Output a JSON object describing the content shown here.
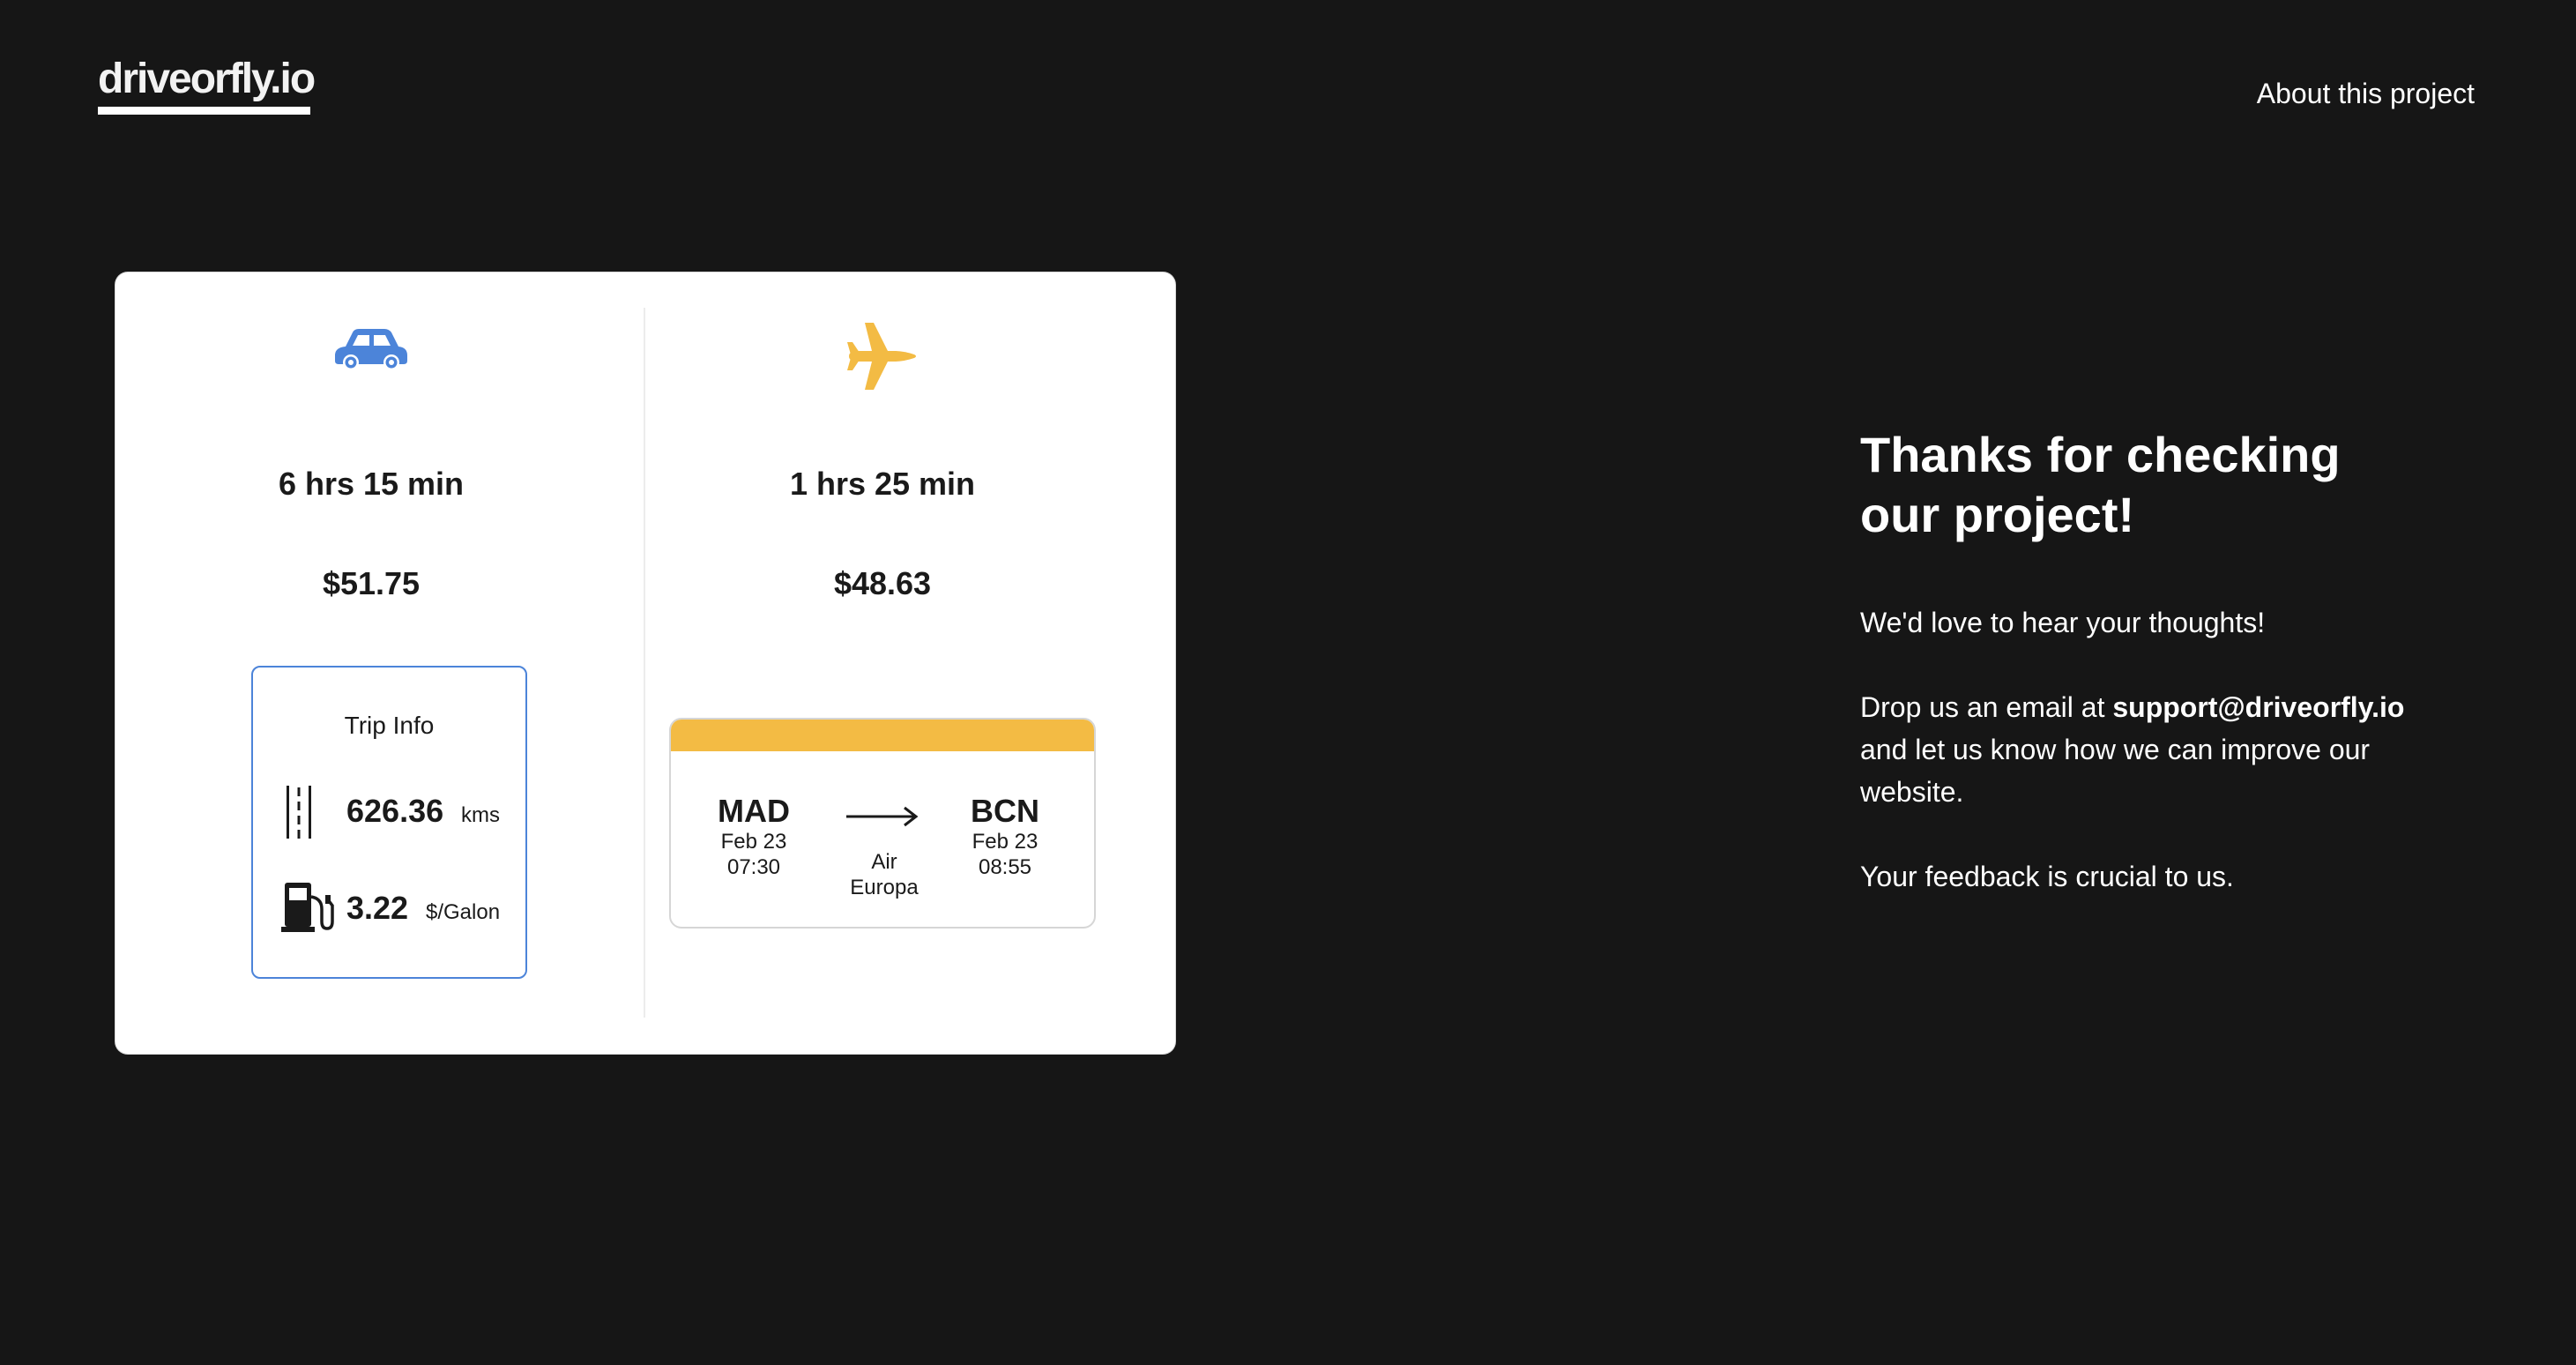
{
  "header": {
    "logo": "driveorfly.io",
    "about_link": "About this project"
  },
  "drive": {
    "icon": "car-icon",
    "duration": "6 hrs 15 min",
    "price": "$51.75",
    "trip_info": {
      "title": "Trip Info",
      "distance_icon": "road-icon",
      "distance_value": "626.36",
      "distance_unit": "kms",
      "fuel_icon": "gas-pump-icon",
      "fuel_value": "3.22",
      "fuel_unit": "$/Galon"
    }
  },
  "fly": {
    "icon": "airplane-icon",
    "duration": "1 hrs 25 min",
    "price": "$48.63",
    "ticket": {
      "from_code": "MAD",
      "from_date": "Feb 23",
      "from_time": "07:30",
      "to_code": "BCN",
      "to_date": "Feb 23",
      "to_time": "08:55",
      "airline_line1": "Air",
      "airline_line2": "Europa"
    }
  },
  "thanks": {
    "title": "Thanks for checking our project!",
    "line1": "We'd love to hear your thoughts!",
    "line2_prefix": "Drop us an email at ",
    "email": "support@driveorfly.io",
    "line2_suffix": " and let us know how we can improve our website.",
    "line3": "Your feedback is crucial to us."
  },
  "colors": {
    "background": "#161616",
    "drive_accent": "#4c84d9",
    "fly_accent": "#f3bb44"
  }
}
